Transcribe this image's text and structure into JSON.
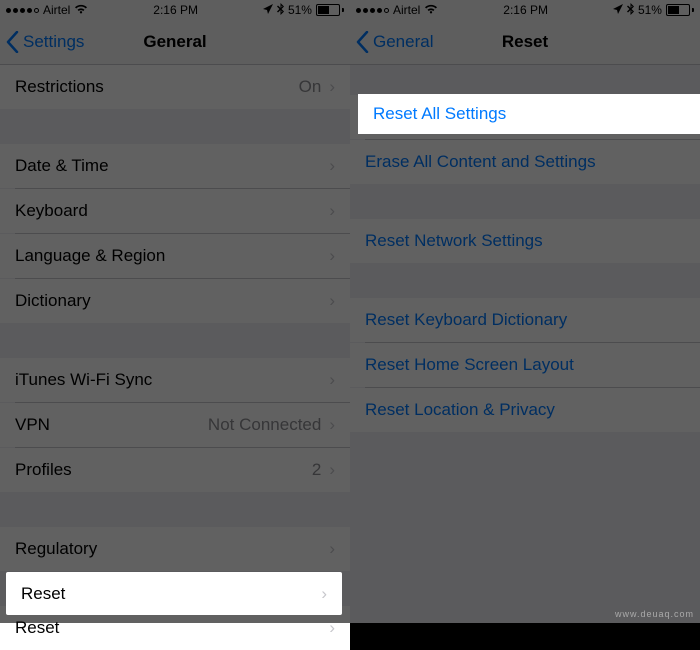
{
  "status": {
    "carrier": "Airtel",
    "time": "2:16 PM",
    "battery_pct": "51%"
  },
  "left": {
    "back": "Settings",
    "title": "General",
    "rows": {
      "restrictions": {
        "label": "Restrictions",
        "value": "On"
      },
      "date_time": {
        "label": "Date & Time"
      },
      "keyboard": {
        "label": "Keyboard"
      },
      "language_region": {
        "label": "Language & Region"
      },
      "dictionary": {
        "label": "Dictionary"
      },
      "itunes_wifi_sync": {
        "label": "iTunes Wi-Fi Sync"
      },
      "vpn": {
        "label": "VPN",
        "value": "Not Connected"
      },
      "profiles": {
        "label": "Profiles",
        "value": "2"
      },
      "regulatory": {
        "label": "Regulatory"
      },
      "reset": {
        "label": "Reset"
      }
    }
  },
  "right": {
    "back": "General",
    "title": "Reset",
    "rows": {
      "reset_all": "Reset All Settings",
      "erase_all": "Erase All Content and Settings",
      "reset_network": "Reset Network Settings",
      "reset_keyboard": "Reset Keyboard Dictionary",
      "reset_home": "Reset Home Screen Layout",
      "reset_location": "Reset Location & Privacy"
    }
  },
  "watermark": "www.deuaq.com"
}
